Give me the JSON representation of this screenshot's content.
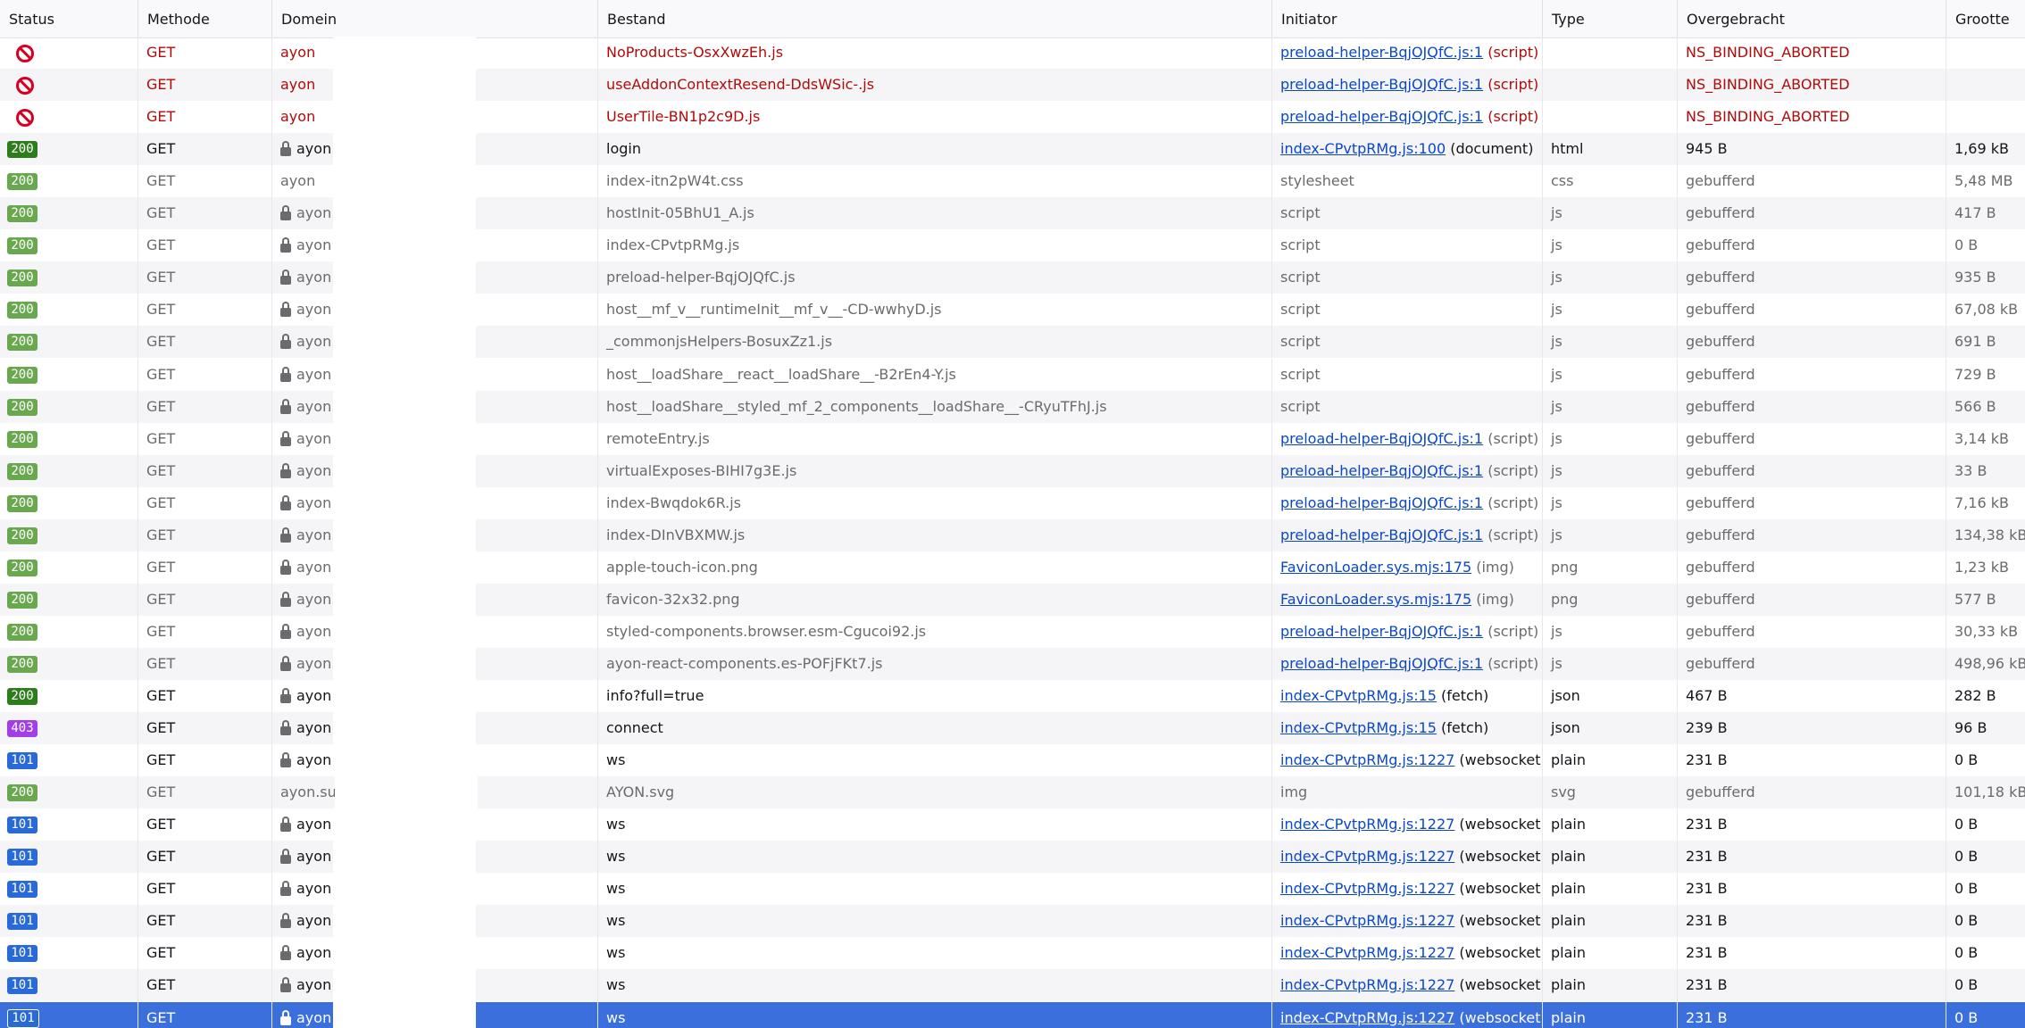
{
  "columns": [
    "Status",
    "Methode",
    "Domein",
    "Bestand",
    "Initiator",
    "Type",
    "Overgebracht",
    "Grootte"
  ],
  "rows": [
    {
      "status": "blocked",
      "method": "GET",
      "domain": "ayon",
      "lock": false,
      "file": "NoProducts-OsxXwzEh.js",
      "init_link": "preload-helper-BqjOJQfC.js:1",
      "init_suffix": " (script)",
      "type": "",
      "transferred": "NS_BINDING_ABORTED",
      "size": "",
      "style": "err"
    },
    {
      "status": "blocked",
      "method": "GET",
      "domain": "ayon",
      "lock": false,
      "file": "useAddonContextResend-DdsWSic-.js",
      "init_link": "preload-helper-BqjOJQfC.js:1",
      "init_suffix": " (script)",
      "type": "",
      "transferred": "NS_BINDING_ABORTED",
      "size": "",
      "style": "err"
    },
    {
      "status": "blocked",
      "method": "GET",
      "domain": "ayon",
      "lock": false,
      "file": "UserTile-BN1p2c9D.js",
      "init_link": "preload-helper-BqjOJQfC.js:1",
      "init_suffix": " (script)",
      "type": "",
      "transferred": "NS_BINDING_ABORTED",
      "size": "",
      "style": "err"
    },
    {
      "status": "200",
      "method": "GET",
      "domain": "ayon.",
      "lock": true,
      "file": "login",
      "init_link": "index-CPvtpRMg.js:100",
      "init_suffix": " (document)",
      "type": "html",
      "transferred": "945 B",
      "size": "1,69 kB",
      "style": "normal"
    },
    {
      "status": "200",
      "method": "GET",
      "domain": "ayon",
      "lock": false,
      "file": "index-itn2pW4t.css",
      "init_link": "",
      "init_suffix": "stylesheet",
      "type": "css",
      "transferred": "gebufferd",
      "size": "5,48 MB",
      "style": "dim"
    },
    {
      "status": "200",
      "method": "GET",
      "domain": "ayon",
      "lock": true,
      "file": "hostInit-05BhU1_A.js",
      "init_link": "",
      "init_suffix": "script",
      "type": "js",
      "transferred": "gebufferd",
      "size": "417 B",
      "style": "dim"
    },
    {
      "status": "200",
      "method": "GET",
      "domain": "ayon",
      "lock": true,
      "file": "index-CPvtpRMg.js",
      "init_link": "",
      "init_suffix": "script",
      "type": "js",
      "transferred": "gebufferd",
      "size": "0 B",
      "style": "dim"
    },
    {
      "status": "200",
      "method": "GET",
      "domain": "ayon",
      "lock": true,
      "file": "preload-helper-BqjOJQfC.js",
      "init_link": "",
      "init_suffix": "script",
      "type": "js",
      "transferred": "gebufferd",
      "size": "935 B",
      "style": "dim"
    },
    {
      "status": "200",
      "method": "GET",
      "domain": "ayon",
      "lock": true,
      "file": "host__mf_v__runtimeInit__mf_v__-CD-wwhyD.js",
      "init_link": "",
      "init_suffix": "script",
      "type": "js",
      "transferred": "gebufferd",
      "size": "67,08 kB",
      "style": "dim"
    },
    {
      "status": "200",
      "method": "GET",
      "domain": "ayon",
      "lock": true,
      "file": "_commonjsHelpers-BosuxZz1.js",
      "init_link": "",
      "init_suffix": "script",
      "type": "js",
      "transferred": "gebufferd",
      "size": "691 B",
      "style": "dim"
    },
    {
      "status": "200",
      "method": "GET",
      "domain": "ayon",
      "lock": true,
      "file": "host__loadShare__react__loadShare__-B2rEn4-Y.js",
      "init_link": "",
      "init_suffix": "script",
      "type": "js",
      "transferred": "gebufferd",
      "size": "729 B",
      "style": "dim"
    },
    {
      "status": "200",
      "method": "GET",
      "domain": "ayon",
      "lock": true,
      "file": "host__loadShare__styled_mf_2_components__loadShare__-CRyuTFhJ.js",
      "init_link": "",
      "init_suffix": "script",
      "type": "js",
      "transferred": "gebufferd",
      "size": "566 B",
      "style": "dim"
    },
    {
      "status": "200",
      "method": "GET",
      "domain": "ayon",
      "lock": true,
      "file": "remoteEntry.js",
      "init_link": "preload-helper-BqjOJQfC.js:1",
      "init_suffix": " (script)",
      "type": "js",
      "transferred": "gebufferd",
      "size": "3,14 kB",
      "style": "dim"
    },
    {
      "status": "200",
      "method": "GET",
      "domain": "ayon",
      "lock": true,
      "file": "virtualExposes-BIHI7g3E.js",
      "init_link": "preload-helper-BqjOJQfC.js:1",
      "init_suffix": " (script)",
      "type": "js",
      "transferred": "gebufferd",
      "size": "33 B",
      "style": "dim"
    },
    {
      "status": "200",
      "method": "GET",
      "domain": "ayon",
      "lock": true,
      "file": "index-Bwqdok6R.js",
      "init_link": "preload-helper-BqjOJQfC.js:1",
      "init_suffix": " (script)",
      "type": "js",
      "transferred": "gebufferd",
      "size": "7,16 kB",
      "style": "dim"
    },
    {
      "status": "200",
      "method": "GET",
      "domain": "ayon",
      "lock": true,
      "file": "index-DInVBXMW.js",
      "init_link": "preload-helper-BqjOJQfC.js:1",
      "init_suffix": " (script)",
      "type": "js",
      "transferred": "gebufferd",
      "size": "134,38 kB",
      "style": "dim"
    },
    {
      "status": "200",
      "method": "GET",
      "domain": "ayon",
      "lock": true,
      "file": "apple-touch-icon.png",
      "init_link": "FaviconLoader.sys.mjs:175",
      "init_suffix": " (img)",
      "type": "png",
      "transferred": "gebufferd",
      "size": "1,23 kB",
      "style": "dim"
    },
    {
      "status": "200",
      "method": "GET",
      "domain": "ayon",
      "lock": true,
      "file": "favicon-32x32.png",
      "init_link": "FaviconLoader.sys.mjs:175",
      "init_suffix": " (img)",
      "type": "png",
      "transferred": "gebufferd",
      "size": "577 B",
      "style": "dim"
    },
    {
      "status": "200",
      "method": "GET",
      "domain": "ayon",
      "lock": true,
      "file": "styled-components.browser.esm-Cgucoi92.js",
      "init_link": "preload-helper-BqjOJQfC.js:1",
      "init_suffix": " (script)",
      "type": "js",
      "transferred": "gebufferd",
      "size": "30,33 kB",
      "style": "dim"
    },
    {
      "status": "200",
      "method": "GET",
      "domain": "ayon",
      "lock": true,
      "file": "ayon-react-components.es-POFjFKt7.js",
      "init_link": "preload-helper-BqjOJQfC.js:1",
      "init_suffix": " (script)",
      "type": "js",
      "transferred": "gebufferd",
      "size": "498,96 kB",
      "style": "dim"
    },
    {
      "status": "200",
      "method": "GET",
      "domain": "ayon",
      "lock": true,
      "file": "info?full=true",
      "init_link": "index-CPvtpRMg.js:15",
      "init_suffix": " (fetch)",
      "type": "json",
      "transferred": "467 B",
      "size": "282 B",
      "style": "normal"
    },
    {
      "status": "403",
      "method": "GET",
      "domain": "ayon",
      "lock": true,
      "file": "connect",
      "init_link": "index-CPvtpRMg.js:15",
      "init_suffix": " (fetch)",
      "type": "json",
      "transferred": "239 B",
      "size": "96 B",
      "style": "normal"
    },
    {
      "status": "101",
      "method": "GET",
      "domain": "ayon",
      "lock": true,
      "file": "ws",
      "init_link": "index-CPvtpRMg.js:1227",
      "init_suffix": " (websocket)",
      "type": "plain",
      "transferred": "231 B",
      "size": "0 B",
      "style": "normal"
    },
    {
      "status": "200",
      "method": "GET",
      "domain": "ayon.sub",
      "lock": false,
      "file": "AYON.svg",
      "init_link": "",
      "init_suffix": "img",
      "type": "svg",
      "transferred": "gebufferd",
      "size": "101,18 kB",
      "style": "dim"
    },
    {
      "status": "101",
      "method": "GET",
      "domain": "ayon",
      "lock": true,
      "file": "ws",
      "init_link": "index-CPvtpRMg.js:1227",
      "init_suffix": " (websocket)",
      "type": "plain",
      "transferred": "231 B",
      "size": "0 B",
      "style": "normal"
    },
    {
      "status": "101",
      "method": "GET",
      "domain": "ayon",
      "lock": true,
      "file": "ws",
      "init_link": "index-CPvtpRMg.js:1227",
      "init_suffix": " (websocket)",
      "type": "plain",
      "transferred": "231 B",
      "size": "0 B",
      "style": "normal"
    },
    {
      "status": "101",
      "method": "GET",
      "domain": "ayon",
      "lock": true,
      "file": "ws",
      "init_link": "index-CPvtpRMg.js:1227",
      "init_suffix": " (websocket)",
      "type": "plain",
      "transferred": "231 B",
      "size": "0 B",
      "style": "normal"
    },
    {
      "status": "101",
      "method": "GET",
      "domain": "ayon",
      "lock": true,
      "file": "ws",
      "init_link": "index-CPvtpRMg.js:1227",
      "init_suffix": " (websocket)",
      "type": "plain",
      "transferred": "231 B",
      "size": "0 B",
      "style": "normal"
    },
    {
      "status": "101",
      "method": "GET",
      "domain": "ayon",
      "lock": true,
      "file": "ws",
      "init_link": "index-CPvtpRMg.js:1227",
      "init_suffix": " (websocket)",
      "type": "plain",
      "transferred": "231 B",
      "size": "0 B",
      "style": "normal"
    },
    {
      "status": "101",
      "method": "GET",
      "domain": "ayon",
      "lock": true,
      "file": "ws",
      "init_link": "index-CPvtpRMg.js:1227",
      "init_suffix": " (websocket)",
      "type": "plain",
      "transferred": "231 B",
      "size": "0 B",
      "style": "normal"
    },
    {
      "status": "101",
      "method": "GET",
      "domain": "ayon",
      "lock": true,
      "file": "ws",
      "init_link": "index-CPvtpRMg.js:1227",
      "init_suffix": " (websocket)",
      "type": "plain",
      "transferred": "231 B",
      "size": "0 B",
      "style": "normal",
      "selected": true
    }
  ],
  "status_colors": {
    "200": "#2e7d1d",
    "200_dim": "#6aa84f",
    "403": "#a13ee8",
    "101": "#2a6ad8",
    "101_sel": "#2a6ad8"
  },
  "icons": {
    "blocked": "block-icon",
    "secure": "lock-icon"
  }
}
